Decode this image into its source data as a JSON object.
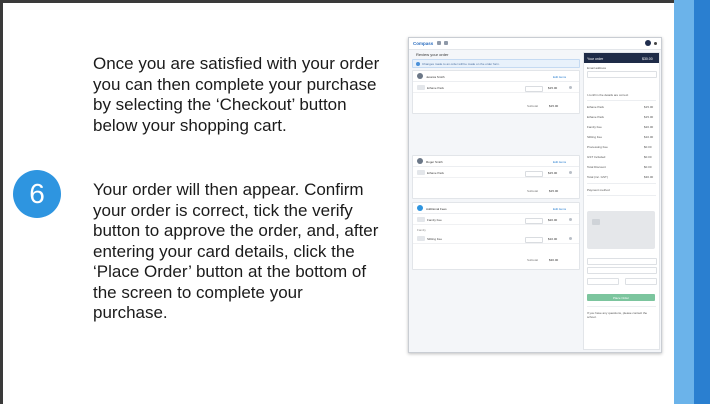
{
  "slide": {
    "paragraph_1": "Once you are satisfied with your order you can then complete your purchase by selecting the ‘Checkout’ button below your shopping cart.",
    "step_number": "6",
    "paragraph_2": "Your order will then appear. Confirm your order is correct, tick the verify button to approve the order, and, after entering your card details, click the ‘Place Order’ button at the bottom of the screen to complete your purchase."
  },
  "screenshot": {
    "brand": "Compass",
    "review_title": "Review your order",
    "notice": "Changes made to an order will be made on the order form.",
    "groups": [
      {
        "name": "Jessica Smith",
        "link": "Edit items",
        "items": [
          {
            "name": "Ethane Pack",
            "price": "$15.00"
          }
        ],
        "subtotal_label": "Subtotal",
        "subtotal": "$15.00"
      },
      {
        "name": "Roger Smith",
        "link": "Edit items",
        "items": [
          {
            "name": "Ethane Pack",
            "price": "$15.00"
          }
        ],
        "subtotal_label": "Subtotal",
        "subtotal": "$15.00"
      },
      {
        "name": "Additional Fees",
        "link": "Edit items",
        "items": [
          {
            "name": "Family Fee",
            "price": "$20.00"
          },
          {
            "name": "Sibling Fee",
            "price": "$10.00"
          }
        ],
        "section_label": "Family",
        "subtotal_label": "Subtotal",
        "subtotal": "$30.00"
      }
    ],
    "panel": {
      "title": "Your order",
      "total": "$30.00",
      "email_label": "Email address",
      "terms_text": "I confirm the details are correct",
      "lines": [
        {
          "label": "Ethane Pack",
          "value": "$15.00"
        },
        {
          "label": "Ethane Pack",
          "value": "$15.00"
        },
        {
          "label": "Family Fee",
          "value": "$20.00"
        },
        {
          "label": "Sibling Fee",
          "value": "$10.00"
        },
        {
          "label": "Processing Fee",
          "value": "$0.00"
        },
        {
          "label": "GST Included",
          "value": "$0.00"
        },
        {
          "label": "Total Discount",
          "value": "$0.00"
        },
        {
          "label": "Total (inc. GST)",
          "value": "$30.00"
        }
      ],
      "payment_label": "Payment method",
      "place_order": "Place Order",
      "help_text": "If you have any questions, please contact the school."
    }
  }
}
